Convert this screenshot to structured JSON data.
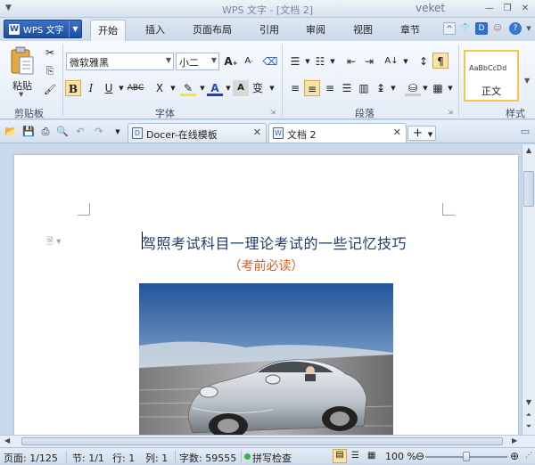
{
  "window": {
    "title": "WPS 文字 - [文档 2]",
    "user": "veket"
  },
  "app_button": {
    "label": "WPS 文字"
  },
  "ribbon_tabs": [
    "开始",
    "插入",
    "页面布局",
    "引用",
    "审阅",
    "视图",
    "章节"
  ],
  "ribbon": {
    "clipboard": {
      "paste_label": "粘贴",
      "group_label": "剪贴板"
    },
    "font": {
      "font_name": "微软雅黑",
      "font_size": "小二",
      "group_label": "字体",
      "bold": "B",
      "italic": "I",
      "underline": "U",
      "strike": "ABC",
      "superscript": "X",
      "color_a": "A",
      "shade_a": "A",
      "phonetic": "变"
    },
    "paragraph": {
      "group_label": "段落"
    },
    "styles": {
      "sample": "AaBbCcDd",
      "style_name": "正文",
      "group_label": "样式"
    }
  },
  "doc_tabs": [
    {
      "label": "Docer-在线模板",
      "active": false
    },
    {
      "label": "文档 2",
      "active": true
    }
  ],
  "document": {
    "title": "驾照考试科目一理论考试的一些记忆技巧",
    "subtitle": "（考前必读）"
  },
  "statusbar": {
    "page": "页面: 1/125",
    "section": "节: 1/1",
    "line": "行: 1",
    "column": "列: 1",
    "word_count": "字数: 59555",
    "spellcheck": "拼写检查",
    "zoom": "100 %"
  },
  "colors": {
    "accent": "#1d4ea6",
    "subtitle": "#e05a1e",
    "title": "#1f3c6e"
  }
}
